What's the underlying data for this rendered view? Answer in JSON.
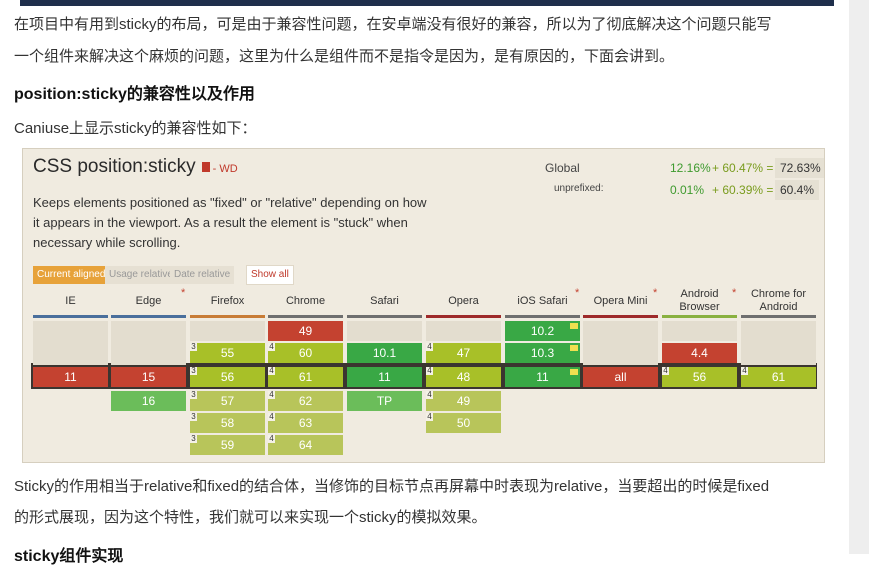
{
  "paragraphs": {
    "p1_line1": "在项目中有用到sticky的布局，可是由于兼容性问题，在安卓端没有很好的兼容，所以为了彻底解决这个问题只能写",
    "p1_line2": "一个组件来解决这个麻烦的问题，这里为什么是组件而不是指令是因为，是有原因的，下面会讲到。",
    "h_compat": "position:sticky的兼容性以及作用",
    "p_caniuse": "Caniuse上显示sticky的兼容性如下：",
    "p2_line1": "Sticky的作用相当于relative和fixed的结合体，当修饰的目标节点再屏幕中时表现为relative，当要超出的时候是fixed",
    "p2_line2": "的形式展现，因为这个特性，我们就可以来实现一个sticky的模拟效果。",
    "h_component": "sticky组件实现"
  },
  "caniuse": {
    "title": "CSS position:sticky",
    "status": "- WD",
    "description": "Keeps elements positioned as \"fixed\" or \"relative\" depending on how it appears in the viewport. As a result the element is \"stuck\" when necessary while scrolling.",
    "global_label": "Global",
    "global_a": "12.16%",
    "global_b": "+ 60.47% =",
    "global_total": "72.63%",
    "unprefixed_label": "unprefixed:",
    "unpref_a": "0.01%",
    "unpref_b": "+ 60.39% =",
    "unpref_total": "60.4%",
    "tabs": {
      "current": "Current aligned",
      "usage": "Usage relative",
      "date": "Date relative",
      "showall": "Show all"
    },
    "colors": {
      "unsupported": "#c44230",
      "partial": "#a8c028",
      "supported": "#39a845",
      "current_row": "#3b3530"
    },
    "browsers": {
      "ie": {
        "name": "IE",
        "current": "11"
      },
      "edge": {
        "name": "Edge",
        "current": "15",
        "future": "16"
      },
      "firefox": {
        "name": "Firefox",
        "past": "55",
        "current": "56",
        "f1": "57",
        "f2": "58",
        "f3": "59"
      },
      "chrome": {
        "name": "Chrome",
        "p1": "49",
        "p2": "60",
        "current": "61",
        "f1": "62",
        "f2": "63",
        "f3": "64"
      },
      "safari": {
        "name": "Safari",
        "past": "10.1",
        "current": "11",
        "future": "TP"
      },
      "opera": {
        "name": "Opera",
        "past": "47",
        "current": "48",
        "f1": "49",
        "f2": "50"
      },
      "ios": {
        "name": "iOS Safari",
        "p1": "10.2",
        "p2": "10.3",
        "current": "11"
      },
      "operamini": {
        "name": "Opera Mini",
        "current": "all"
      },
      "android": {
        "name": "Android Browser",
        "past": "4.4",
        "current": "56"
      },
      "chromeandroid": {
        "name": "Chrome for Android",
        "current": "61"
      }
    },
    "note_marks": {
      "n3": "3",
      "n4": "4"
    }
  }
}
